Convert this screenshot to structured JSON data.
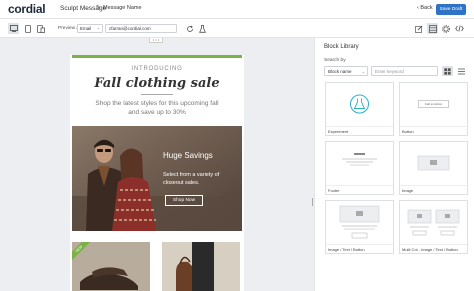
{
  "header": {
    "logo": "cordial",
    "app_title": "Sculpt Message",
    "message_name": "Message Name",
    "back_label": "Back",
    "save_label": "Save Draft"
  },
  "toolbar": {
    "preview_label": "Preview as",
    "channel_select": "Email",
    "email_value": "cfarran@cordial.com"
  },
  "email": {
    "intro": "INTRODUCING",
    "headline": "Fall clothing sale",
    "subtext": "Shop the latest styles for this upcoming fall and save up to 30%",
    "hero": {
      "title": "Huge Savings",
      "body": "Select from a variety of closeout sales.",
      "button": "Shop Now"
    },
    "badge": "NEW"
  },
  "panel": {
    "title": "Block Library",
    "search_by": "Search by",
    "block_select": "Block name",
    "keyword_placeholder": "Enter keyword",
    "cards": [
      {
        "label": "Experiment"
      },
      {
        "label": "Button",
        "preview_text": "Call to Action"
      },
      {
        "label": "Footer"
      },
      {
        "label": "Image"
      },
      {
        "label": "Image / Text / Button"
      },
      {
        "label": "Multi Col - Image / Text / Button"
      }
    ]
  },
  "colors": {
    "accent": "#2e73c6",
    "brand_green": "#7ab344",
    "experiment_teal": "#2bb0c9"
  }
}
